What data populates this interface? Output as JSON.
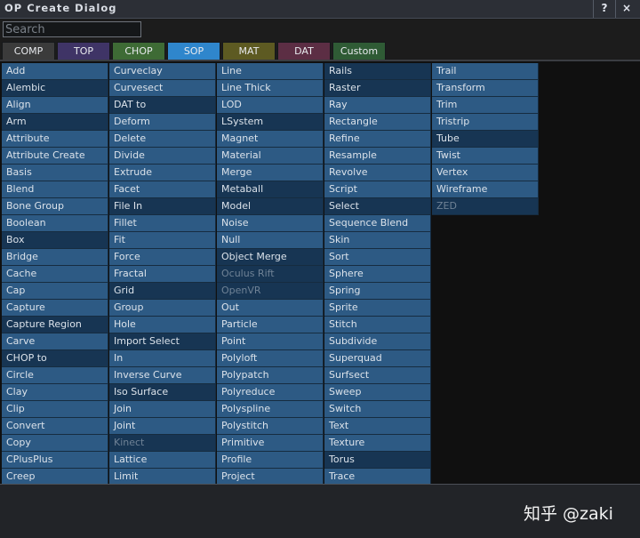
{
  "window": {
    "title": "OP Create Dialog",
    "help": "?",
    "close": "×"
  },
  "search": {
    "placeholder": "Search",
    "value": ""
  },
  "tabs": [
    {
      "label": "COMP",
      "color": "#3b3b3b"
    },
    {
      "label": "TOP",
      "color": "#3f3466"
    },
    {
      "label": "CHOP",
      "color": "#3e6b35"
    },
    {
      "label": "SOP",
      "color": "#2f86cc"
    },
    {
      "label": "MAT",
      "color": "#5d5a22"
    },
    {
      "label": "DAT",
      "color": "#5c2e44"
    },
    {
      "label": "Custom",
      "color": "#2f5b35"
    }
  ],
  "active_tab": "SOP",
  "columns": [
    [
      {
        "label": "Add",
        "s": "light"
      },
      {
        "label": "Alembic",
        "s": "dark"
      },
      {
        "label": "Align",
        "s": "light"
      },
      {
        "label": "Arm",
        "s": "dark"
      },
      {
        "label": "Attribute",
        "s": "light"
      },
      {
        "label": "Attribute Create",
        "s": "light"
      },
      {
        "label": "Basis",
        "s": "light"
      },
      {
        "label": "Blend",
        "s": "light"
      },
      {
        "label": "Bone Group",
        "s": "light"
      },
      {
        "label": "Boolean",
        "s": "light"
      },
      {
        "label": "Box",
        "s": "dark"
      },
      {
        "label": "Bridge",
        "s": "light"
      },
      {
        "label": "Cache",
        "s": "light"
      },
      {
        "label": "Cap",
        "s": "light"
      },
      {
        "label": "Capture",
        "s": "light"
      },
      {
        "label": "Capture Region",
        "s": "dark"
      },
      {
        "label": "Carve",
        "s": "light"
      },
      {
        "label": "CHOP to",
        "s": "dark"
      },
      {
        "label": "Circle",
        "s": "light"
      },
      {
        "label": "Clay",
        "s": "light"
      },
      {
        "label": "Clip",
        "s": "light"
      },
      {
        "label": "Convert",
        "s": "light"
      },
      {
        "label": "Copy",
        "s": "light"
      },
      {
        "label": "CPlusPlus",
        "s": "light"
      },
      {
        "label": "Creep",
        "s": "light"
      }
    ],
    [
      {
        "label": "Curveclay",
        "s": "light"
      },
      {
        "label": "Curvesect",
        "s": "light"
      },
      {
        "label": "DAT to",
        "s": "dark"
      },
      {
        "label": "Deform",
        "s": "light"
      },
      {
        "label": "Delete",
        "s": "light"
      },
      {
        "label": "Divide",
        "s": "light"
      },
      {
        "label": "Extrude",
        "s": "light"
      },
      {
        "label": "Facet",
        "s": "light"
      },
      {
        "label": "File In",
        "s": "dark"
      },
      {
        "label": "Fillet",
        "s": "light"
      },
      {
        "label": "Fit",
        "s": "light"
      },
      {
        "label": "Force",
        "s": "light"
      },
      {
        "label": "Fractal",
        "s": "light"
      },
      {
        "label": "Grid",
        "s": "dark"
      },
      {
        "label": "Group",
        "s": "light"
      },
      {
        "label": "Hole",
        "s": "light"
      },
      {
        "label": "Import Select",
        "s": "dark"
      },
      {
        "label": "In",
        "s": "light"
      },
      {
        "label": "Inverse Curve",
        "s": "light"
      },
      {
        "label": "Iso Surface",
        "s": "dark"
      },
      {
        "label": "Join",
        "s": "light"
      },
      {
        "label": "Joint",
        "s": "light"
      },
      {
        "label": "Kinect",
        "s": "dark",
        "disabled": true
      },
      {
        "label": "Lattice",
        "s": "light"
      },
      {
        "label": "Limit",
        "s": "light"
      }
    ],
    [
      {
        "label": "Line",
        "s": "light"
      },
      {
        "label": "Line Thick",
        "s": "light"
      },
      {
        "label": "LOD",
        "s": "light"
      },
      {
        "label": "LSystem",
        "s": "dark"
      },
      {
        "label": "Magnet",
        "s": "light"
      },
      {
        "label": "Material",
        "s": "light"
      },
      {
        "label": "Merge",
        "s": "light"
      },
      {
        "label": "Metaball",
        "s": "dark"
      },
      {
        "label": "Model",
        "s": "dark"
      },
      {
        "label": "Noise",
        "s": "light"
      },
      {
        "label": "Null",
        "s": "light"
      },
      {
        "label": "Object Merge",
        "s": "dark"
      },
      {
        "label": "Oculus Rift",
        "s": "dark",
        "disabled": true
      },
      {
        "label": "OpenVR",
        "s": "dark",
        "disabled": true
      },
      {
        "label": "Out",
        "s": "light"
      },
      {
        "label": "Particle",
        "s": "light"
      },
      {
        "label": "Point",
        "s": "light"
      },
      {
        "label": "Polyloft",
        "s": "light"
      },
      {
        "label": "Polypatch",
        "s": "light"
      },
      {
        "label": "Polyreduce",
        "s": "light"
      },
      {
        "label": "Polyspline",
        "s": "light"
      },
      {
        "label": "Polystitch",
        "s": "light"
      },
      {
        "label": "Primitive",
        "s": "light"
      },
      {
        "label": "Profile",
        "s": "light"
      },
      {
        "label": "Project",
        "s": "light"
      }
    ],
    [
      {
        "label": "Rails",
        "s": "dark"
      },
      {
        "label": "Raster",
        "s": "dark"
      },
      {
        "label": "Ray",
        "s": "light"
      },
      {
        "label": "Rectangle",
        "s": "light"
      },
      {
        "label": "Refine",
        "s": "light"
      },
      {
        "label": "Resample",
        "s": "light"
      },
      {
        "label": "Revolve",
        "s": "light"
      },
      {
        "label": "Script",
        "s": "light"
      },
      {
        "label": "Select",
        "s": "dark"
      },
      {
        "label": "Sequence Blend",
        "s": "light"
      },
      {
        "label": "Skin",
        "s": "light"
      },
      {
        "label": "Sort",
        "s": "light"
      },
      {
        "label": "Sphere",
        "s": "light"
      },
      {
        "label": "Spring",
        "s": "light"
      },
      {
        "label": "Sprite",
        "s": "light"
      },
      {
        "label": "Stitch",
        "s": "light"
      },
      {
        "label": "Subdivide",
        "s": "light"
      },
      {
        "label": "Superquad",
        "s": "light"
      },
      {
        "label": "Surfsect",
        "s": "light"
      },
      {
        "label": "Sweep",
        "s": "light"
      },
      {
        "label": "Switch",
        "s": "light"
      },
      {
        "label": "Text",
        "s": "light"
      },
      {
        "label": "Texture",
        "s": "light"
      },
      {
        "label": "Torus",
        "s": "dark"
      },
      {
        "label": "Trace",
        "s": "light"
      }
    ],
    [
      {
        "label": "Trail",
        "s": "light"
      },
      {
        "label": "Transform",
        "s": "light"
      },
      {
        "label": "Trim",
        "s": "light"
      },
      {
        "label": "Tristrip",
        "s": "light"
      },
      {
        "label": "Tube",
        "s": "dark"
      },
      {
        "label": "Twist",
        "s": "light"
      },
      {
        "label": "Vertex",
        "s": "light"
      },
      {
        "label": "Wireframe",
        "s": "light"
      },
      {
        "label": "ZED",
        "s": "dark",
        "disabled": true
      }
    ]
  ],
  "watermark": "知乎 @zaki"
}
